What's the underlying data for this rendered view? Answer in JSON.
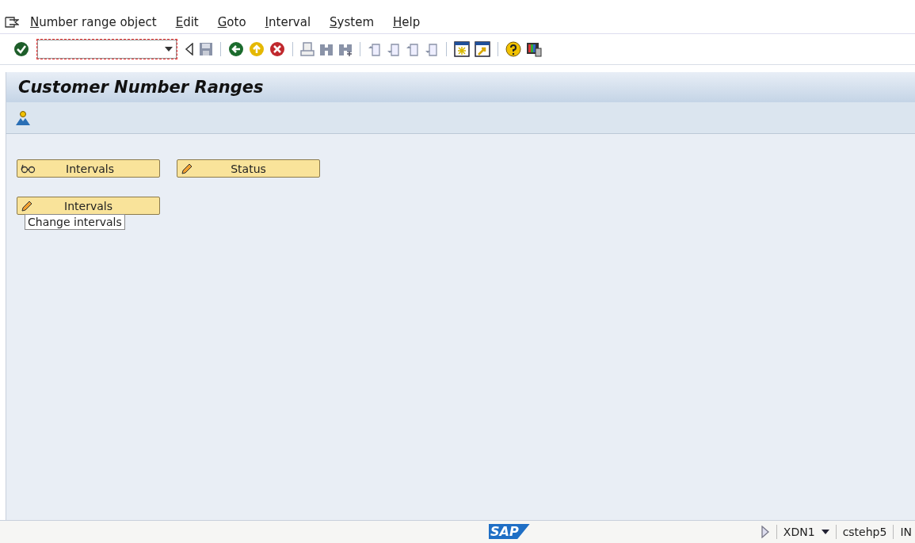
{
  "menu_bar": [
    "Number range object",
    "Edit",
    "Goto",
    "Interval",
    "System",
    "Help"
  ],
  "title": "Customer Number Ranges",
  "buttons": [
    {
      "label": "Intervals",
      "kind": "glasses"
    },
    {
      "label": "Status",
      "kind": "pencil"
    },
    {
      "label": "Intervals",
      "kind": "pencil"
    }
  ],
  "tooltip": "Change intervals",
  "status_bar": {
    "logo": "SAP",
    "system": "XDN1",
    "server": "cstehp5",
    "mode": "IN"
  }
}
